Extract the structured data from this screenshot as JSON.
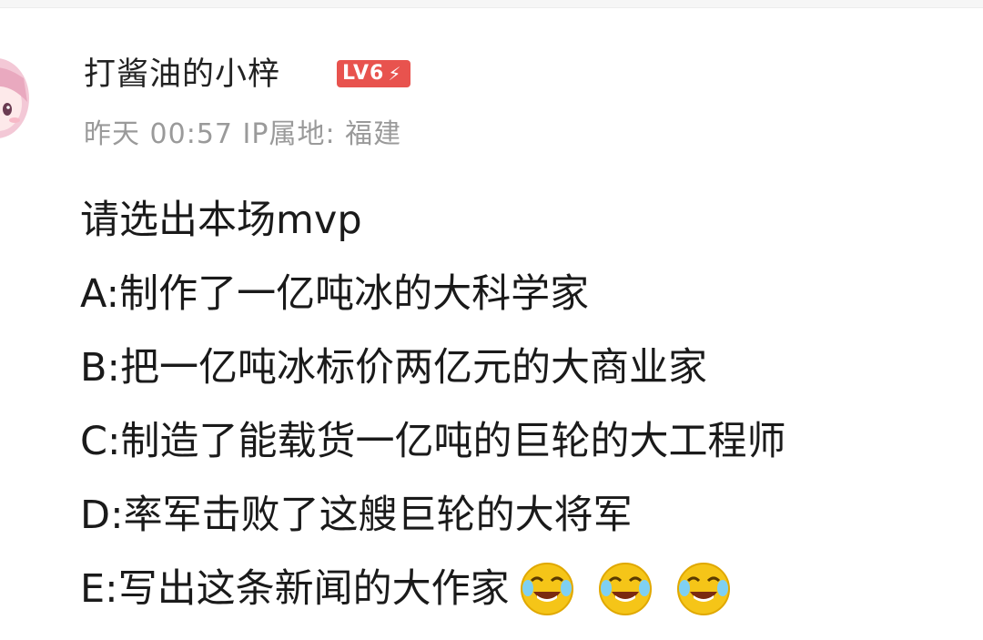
{
  "user": {
    "name": "打酱油的小梓",
    "level": "LV6",
    "timestamp": "昨天 00:57",
    "ip_location": "IP属地: 福建"
  },
  "post": {
    "prompt": "请选出本场mvp",
    "options": [
      "A:制作了一亿吨冰的大科学家",
      "B:把一亿吨冰标价两亿元的大商业家",
      "C:制造了能载货一亿吨的巨轮的大工程师",
      "D:率军击败了这艘巨轮的大将军",
      "E:写出这条新闻的大作家"
    ],
    "emojis": [
      "laughing-crying-emoji",
      "laughing-crying-emoji",
      "laughing-crying-emoji"
    ]
  },
  "colors": {
    "badge": "#e8534e",
    "meta_text": "#9a9a9a",
    "body_text": "#1a1a1a",
    "emoji_yellow": "#f5c518"
  }
}
